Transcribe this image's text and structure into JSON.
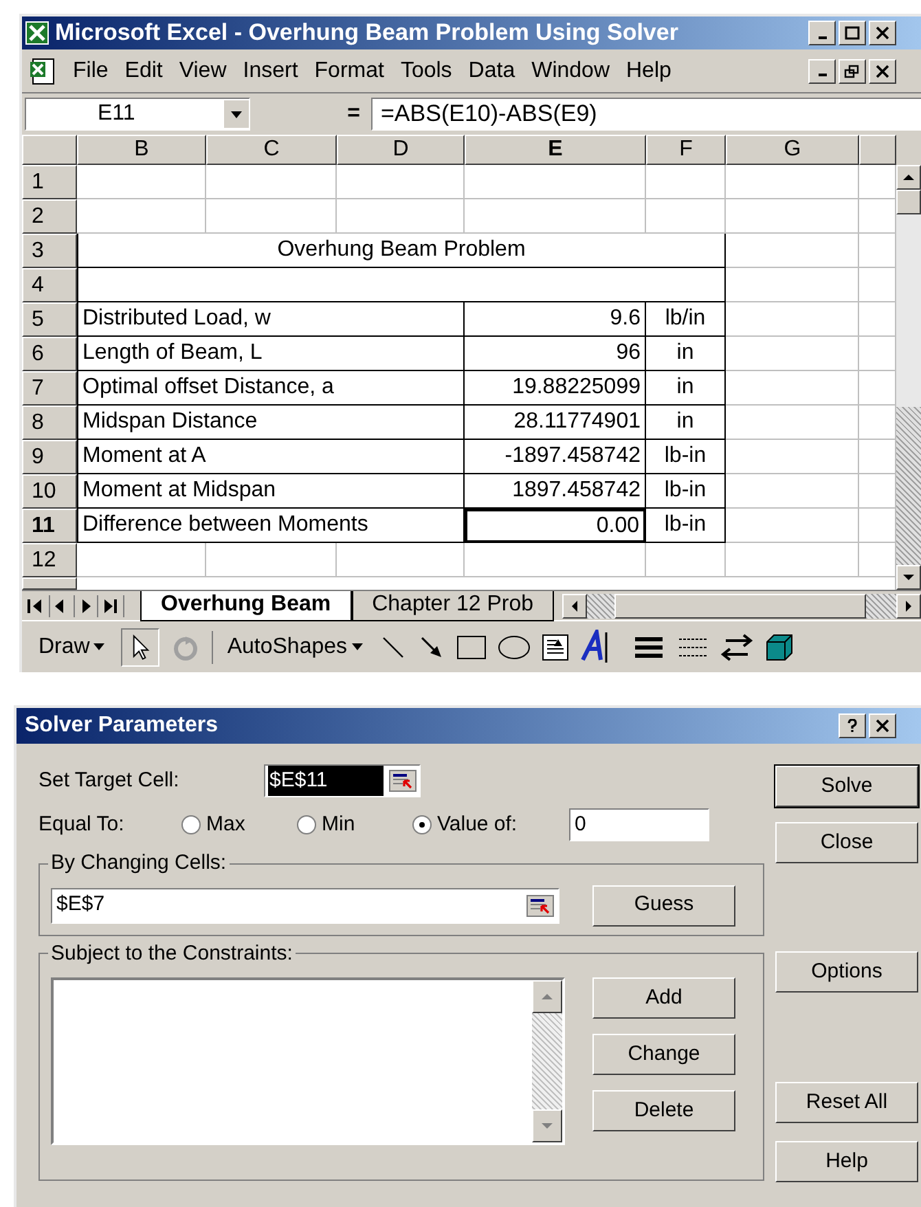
{
  "window": {
    "title": "Microsoft Excel - Overhung Beam Problem Using Solver"
  },
  "menu": [
    "File",
    "Edit",
    "View",
    "Insert",
    "Format",
    "Tools",
    "Data",
    "Window",
    "Help"
  ],
  "formula_bar": {
    "name_box": "E11",
    "equals": "=",
    "formula": "=ABS(E10)-ABS(E9)"
  },
  "columns": [
    {
      "label": "B",
      "selected": false
    },
    {
      "label": "C",
      "selected": false
    },
    {
      "label": "D",
      "selected": false
    },
    {
      "label": "E",
      "selected": true
    },
    {
      "label": "F",
      "selected": false
    },
    {
      "label": "G",
      "selected": false
    }
  ],
  "rows": [
    {
      "number": "1",
      "kind": "blank",
      "selected": false
    },
    {
      "number": "2",
      "kind": "blank",
      "selected": false
    },
    {
      "number": "3",
      "kind": "title",
      "selected": false,
      "text": "Overhung Beam Problem"
    },
    {
      "number": "4",
      "kind": "boxed",
      "selected": false
    },
    {
      "number": "5",
      "kind": "data",
      "selected": false,
      "label": "Distributed Load, w",
      "value": "9.6",
      "unit": "lb/in"
    },
    {
      "number": "6",
      "kind": "data",
      "selected": false,
      "label": "Length of Beam, L",
      "value": "96",
      "unit": "in"
    },
    {
      "number": "7",
      "kind": "data",
      "selected": false,
      "label": "Optimal offset Distance, a",
      "value": "19.88225099",
      "unit": "in"
    },
    {
      "number": "8",
      "kind": "data",
      "selected": false,
      "label": "Midspan Distance",
      "value": "28.11774901",
      "unit": "in"
    },
    {
      "number": "9",
      "kind": "data",
      "selected": false,
      "label": "Moment at A",
      "value": "-1897.458742",
      "unit": "lb-in"
    },
    {
      "number": "10",
      "kind": "data",
      "selected": false,
      "label": "Moment at Midspan",
      "value": "1897.458742",
      "unit": "lb-in"
    },
    {
      "number": "11",
      "kind": "data",
      "selected": true,
      "label": "Difference between Moments",
      "value": "0.00",
      "unit": "lb-in"
    },
    {
      "number": "12",
      "kind": "blank",
      "selected": false
    }
  ],
  "sheet_tabs": [
    {
      "label": "Overhung Beam",
      "selected": true
    },
    {
      "label": "Chapter 12 Prob",
      "selected": false
    }
  ],
  "drawing_toolbar": {
    "draw": "Draw",
    "autoshapes": "AutoShapes"
  },
  "dialog": {
    "title": "Solver Parameters",
    "target_label": "Set Target Cell:",
    "target_value": "$E$11",
    "equal_to_label": "Equal To:",
    "equal_to_options": [
      {
        "label": "Max",
        "selected": false
      },
      {
        "label": "Min",
        "selected": false
      },
      {
        "label": "Value of:",
        "selected": true
      }
    ],
    "value_of": "0",
    "changing_label": "By Changing Cells:",
    "changing_value": "$E$7",
    "guess": "Guess",
    "constraints_label": "Subject to the Constraints:",
    "constraint_buttons": [
      "Add",
      "Change",
      "Delete"
    ],
    "side_buttons": [
      {
        "label": "Solve",
        "default": true
      },
      {
        "label": "Close",
        "default": false
      },
      {
        "label": "Options",
        "default": false
      },
      {
        "label": "Reset All",
        "default": false
      },
      {
        "label": "Help",
        "default": false
      }
    ]
  }
}
